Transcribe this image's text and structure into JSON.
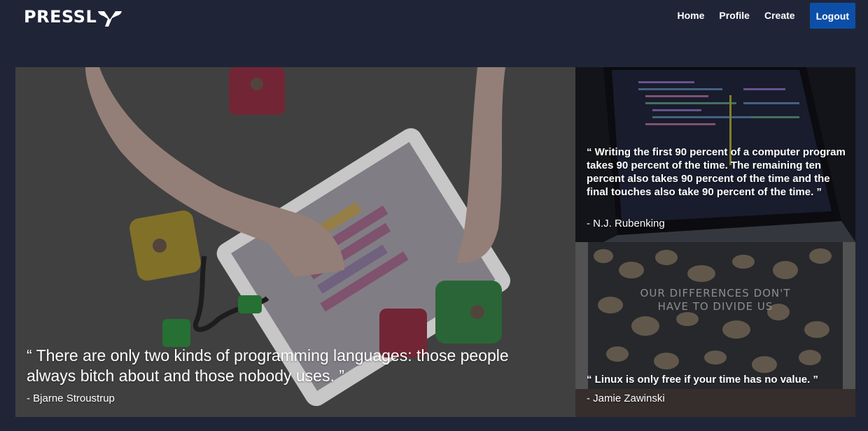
{
  "brand": {
    "name": "PRESSL"
  },
  "nav": {
    "links": [
      "Home",
      "Profile",
      "Create"
    ],
    "logout_label": "Logout"
  },
  "featured": {
    "quote": "“ There are only two kinds of programming languages: those people always bitch about and those nobody uses. ”",
    "author": "- Bjarne Stroustrup"
  },
  "side_posts": [
    {
      "quote": "“ Writing the first 90 percent of a computer program takes 90 percent of the time. The remaining ten percent also takes 90 percent of the time and the final touches also take 90 percent of the time. ”",
      "author": "- N.J. Rubenking"
    },
    {
      "quote": "“ Linux is only free if your time has no value. ”",
      "author": "- Jamie Zawinski",
      "image_text": "OUR DIFFERENCES DON'T HAVE TO DIVIDE US"
    }
  ],
  "colors": {
    "background": "#1f2537",
    "logout_button": "#0d4fa8"
  }
}
